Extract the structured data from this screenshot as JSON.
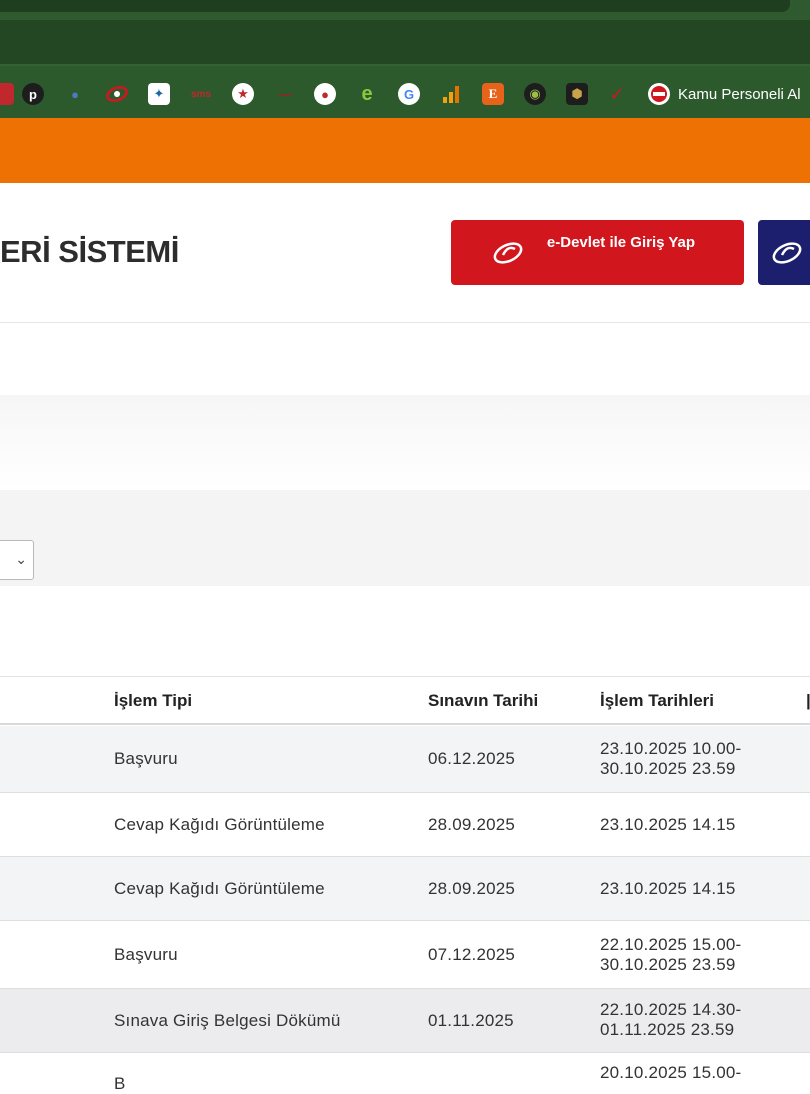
{
  "bookmarks": {
    "icons": [
      "red-circle-icon",
      "p-icon",
      "drop-icon",
      "edevlet-icon",
      "eagle-icon",
      "sms-icon",
      "shield-icon",
      "dash-icon",
      "emblem-icon",
      "e-icon",
      "google-icon",
      "bars-icon",
      "E-icon",
      "globe-icon",
      "badge-icon",
      "check-icon"
    ],
    "last_label": "Kamu Personeli Al"
  },
  "header": {
    "site_title": "ERİ SİSTEMİ",
    "edevlet_button": "e-Devlet ile Giriş Yap"
  },
  "table": {
    "headers": [
      "İşlem Tipi",
      "Sınavın Tarihi",
      "İşlem Tarihleri"
    ],
    "rows": [
      {
        "type": "Başvuru",
        "exam_date": "06.12.2025",
        "dates_1": "23.10.2025 10.00-",
        "dates_2": "30.10.2025 23.59"
      },
      {
        "type": "Cevap Kağıdı Görüntüleme",
        "exam_date": "28.09.2025",
        "dates_1": "23.10.2025 14.15",
        "dates_2": ""
      },
      {
        "type": "Cevap Kağıdı Görüntüleme",
        "exam_date": "28.09.2025",
        "dates_1": "23.10.2025 14.15",
        "dates_2": ""
      },
      {
        "type": "Başvuru",
        "exam_date": "07.12.2025",
        "dates_1": "22.10.2025 15.00-",
        "dates_2": "30.10.2025 23.59"
      },
      {
        "type": "Sınava Giriş Belgesi Dökümü",
        "exam_date": "01.11.2025",
        "dates_1": "22.10.2025 14.30-",
        "dates_2": "01.11.2025 23.59"
      },
      {
        "type": "B",
        "exam_date": "",
        "dates_1": "20.10.2025 15.00-",
        "dates_2": ""
      }
    ]
  },
  "colors": {
    "orange": "#ee7203",
    "edevlet_red": "#d1161e",
    "navy": "#1c1f6e",
    "chrome_green": "#2d5a2d"
  }
}
